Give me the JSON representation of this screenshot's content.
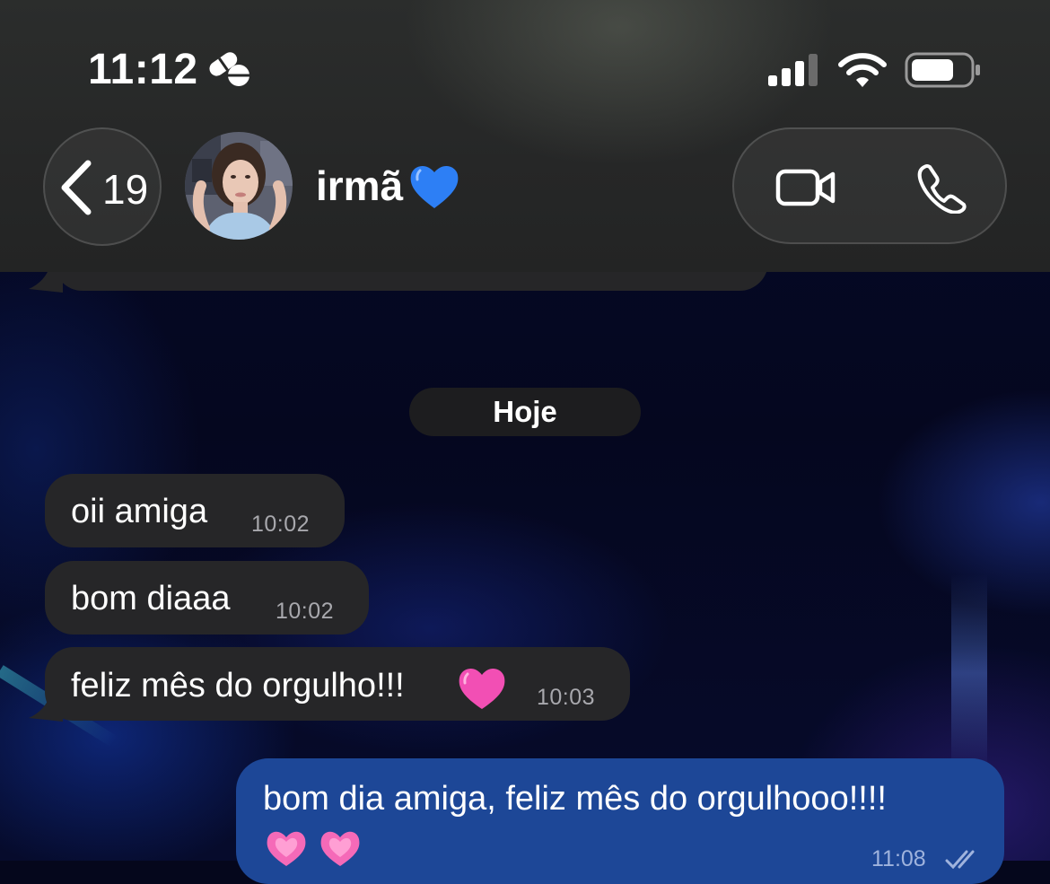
{
  "status_bar": {
    "time": "11:12",
    "icons": [
      "focus-mode-icon",
      "signal-icon",
      "wifi-icon",
      "battery-icon"
    ]
  },
  "header": {
    "back_count": "19",
    "contact_name": "irmã",
    "contact_emoji": "blue-heart-icon",
    "buttons": [
      "video-call-icon",
      "phone-call-icon"
    ]
  },
  "chat": {
    "date_label": "Hoje",
    "messages": [
      {
        "direction": "incoming",
        "text": "oii amiga",
        "time": "10:02"
      },
      {
        "direction": "incoming",
        "text": "bom diaaa",
        "time": "10:02"
      },
      {
        "direction": "incoming",
        "text": "feliz mês do orgulho!!!",
        "emoji": "pink-heart-icon",
        "time": "10:03"
      },
      {
        "direction": "outgoing",
        "text": "bom dia amiga, feliz mês do orgulhooo!!!!",
        "emoji": "sparkling-heart-icon sparkling-heart-icon",
        "time": "11:08",
        "status": "double-check-icon"
      }
    ]
  },
  "colors": {
    "header_bg": "#262727",
    "incoming_bubble": "#262628",
    "outgoing_bubble": "#1d4797",
    "wallpaper": "#05071c"
  }
}
